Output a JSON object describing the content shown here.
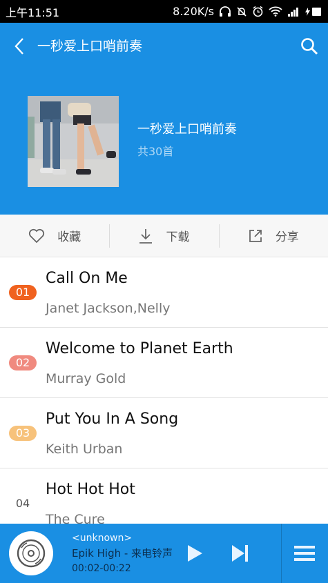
{
  "status_bar": {
    "time": "上午11:51",
    "network_speed": "8.20K/s",
    "icons": [
      "headphone-icon",
      "mute-icon",
      "alarm-icon",
      "wifi-icon",
      "signal-icon",
      "battery-charging-icon"
    ]
  },
  "header": {
    "back_icon": "back-arrow-icon",
    "title": "一秒爱上口哨前奏",
    "search_icon": "search-icon",
    "album_name": "一秒爱上口哨前奏",
    "track_count": "共30首"
  },
  "actions": {
    "favorite": {
      "label": "收藏",
      "icon": "heart-icon"
    },
    "download": {
      "label": "下载",
      "icon": "download-icon"
    },
    "share": {
      "label": "分享",
      "icon": "share-icon"
    }
  },
  "songs": [
    {
      "rank": "01",
      "title": "Call On Me",
      "artist": "Janet Jackson,Nelly",
      "badge_color": "#f0621f"
    },
    {
      "rank": "02",
      "title": "Welcome to Planet Earth",
      "artist": "Murray Gold",
      "badge_color": "#f08a7f"
    },
    {
      "rank": "03",
      "title": "Put You In A Song",
      "artist": "Keith Urban",
      "badge_color": "#f7c27b"
    },
    {
      "rank": "04",
      "title": "Hot Hot Hot",
      "artist": "The Cure",
      "badge_color": ""
    }
  ],
  "now_playing": {
    "source": "<unknown>",
    "track": "Epik High - 来电铃声",
    "time": "00:02-00:22",
    "disc_icon": "disc-icon",
    "play_icon": "play-icon",
    "next_icon": "next-track-icon",
    "menu_icon": "menu-icon"
  },
  "colors": {
    "primary": "#1a8fe3",
    "status_bar": "#000000",
    "action_bar": "#f7f7f7"
  }
}
